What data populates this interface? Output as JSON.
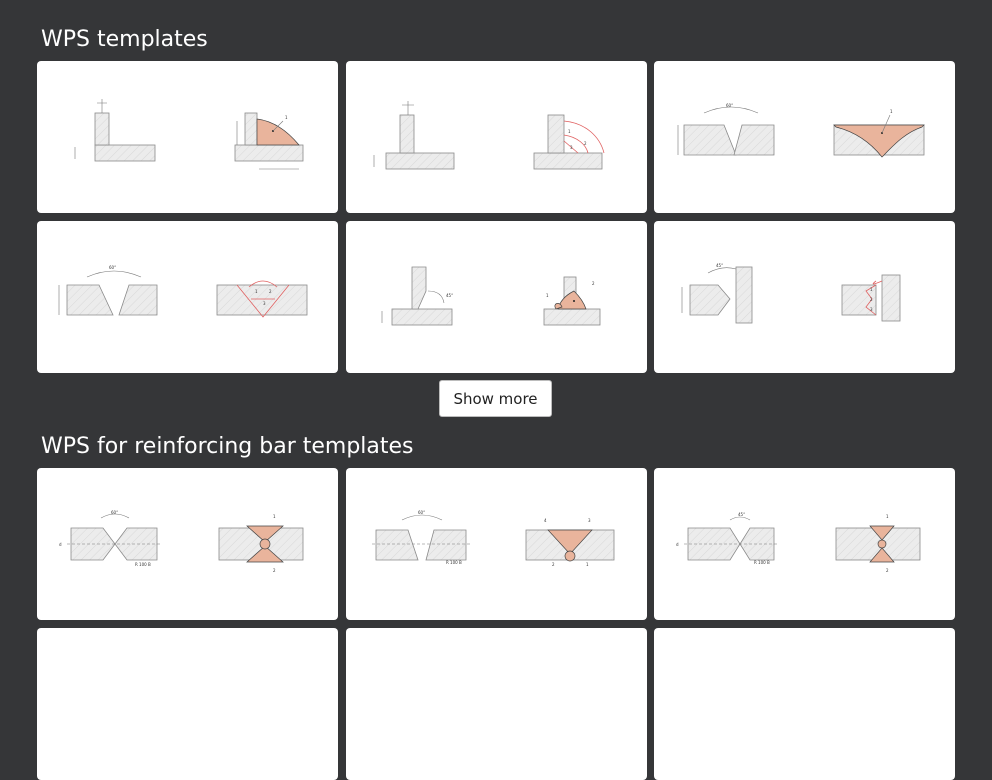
{
  "sections": [
    {
      "title": "WPS templates",
      "show_more_label": "Show more",
      "cards": [
        {
          "name": "tee-fillet-single-bead"
        },
        {
          "name": "tee-fillet-multi-pass"
        },
        {
          "name": "butt-single-v-single-bead"
        },
        {
          "name": "butt-single-v-multi-pass"
        },
        {
          "name": "tee-bevel-single-bead"
        },
        {
          "name": "corner-bevel-multi-pass"
        }
      ]
    },
    {
      "title": "WPS for reinforcing bar templates",
      "cards": [
        {
          "name": "rebar-double-v-60"
        },
        {
          "name": "rebar-double-v-multi-pass"
        },
        {
          "name": "rebar-double-v-45"
        },
        {
          "name": "partial-card-1"
        },
        {
          "name": "partial-card-2"
        },
        {
          "name": "partial-card-3"
        }
      ]
    }
  ],
  "drawing_labels": {
    "angle_60": "60°",
    "angle_45": "45°",
    "bead_1": "1",
    "bead_2": "2",
    "bead_3": "3",
    "bead_4": "4",
    "dim_r": "R 100 B",
    "dim_d": "d"
  }
}
